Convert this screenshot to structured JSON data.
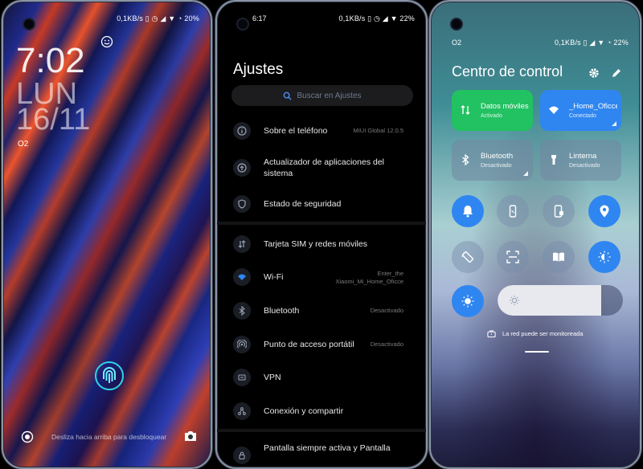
{
  "lock_screen": {
    "status": {
      "right": "0,1KB/s ▯ ◷ ◢ ▼ ◔ 20%"
    },
    "time": "7:02",
    "day": "LUN",
    "date": "16/11",
    "carrier": "O2",
    "unlock_hint": "Desliza hacia arriba para desbloquear"
  },
  "settings": {
    "status": {
      "time": "6:17",
      "right": "0,1KB/s ▯ ◷ ◢ ▼ 22%"
    },
    "title": "Ajustes",
    "search_placeholder": "Buscar en Ajustes",
    "items": [
      {
        "label": "Sobre el teléfono",
        "value": "MIUI Global 12.0.5",
        "icon": "info-icon"
      },
      {
        "label": "Actualizador de aplicaciones del sistema",
        "value": "",
        "icon": "update-icon"
      },
      {
        "label": "Estado de seguridad",
        "value": "",
        "icon": "shield-icon"
      },
      {
        "label": "Tarjeta SIM y redes móviles",
        "value": "",
        "icon": "sim-icon"
      },
      {
        "label": "Wi-Fi",
        "value": "Enter_the Xiaomi_Mi_Home_Oficce",
        "icon": "wifi-icon"
      },
      {
        "label": "Bluetooth",
        "value": "Desactivado",
        "icon": "bluetooth-icon"
      },
      {
        "label": "Punto de acceso portátil",
        "value": "Desactivado",
        "icon": "hotspot-icon"
      },
      {
        "label": "VPN",
        "value": "",
        "icon": "vpn-icon"
      },
      {
        "label": "Conexión y compartir",
        "value": "",
        "icon": "share-icon"
      },
      {
        "label": "Pantalla siempre activa y Pantalla",
        "value": "",
        "icon": "lock-icon"
      }
    ]
  },
  "control_center": {
    "status": {
      "right": "0,1KB/s ▯ ◢ ▼ ◔ 22%"
    },
    "carrier": "O2",
    "title": "Centro de control",
    "tiles": [
      {
        "title": "Datos móviles",
        "subtitle": "Activado",
        "state": "on-green",
        "icon": "data-arrows-icon"
      },
      {
        "title": "_Home_Oficce",
        "subtitle": "Conectado",
        "state": "on-blue",
        "icon": "wifi-icon"
      },
      {
        "title": "Bluetooth",
        "subtitle": "Desactivado",
        "state": "off",
        "icon": "bluetooth-icon"
      },
      {
        "title": "Linterna",
        "subtitle": "Desactivado",
        "state": "off",
        "icon": "flashlight-icon"
      }
    ],
    "toggles": [
      {
        "name": "bell-icon",
        "state": "on"
      },
      {
        "name": "vibrate-icon",
        "state": "off"
      },
      {
        "name": "screenshot-icon",
        "state": "off"
      },
      {
        "name": "location-icon",
        "state": "on"
      },
      {
        "name": "auto-rotate-icon",
        "state": "off"
      },
      {
        "name": "scanner-icon",
        "state": "off"
      },
      {
        "name": "reading-mode-icon",
        "state": "off"
      },
      {
        "name": "dark-mode-icon",
        "state": "on"
      },
      {
        "name": "auto-brightness-icon",
        "state": "on"
      }
    ],
    "brightness_level": 0.83,
    "notice": "La red puede ser monitoreada",
    "colors": {
      "accent_blue": "#2f86f0",
      "accent_green": "#22c162"
    }
  }
}
